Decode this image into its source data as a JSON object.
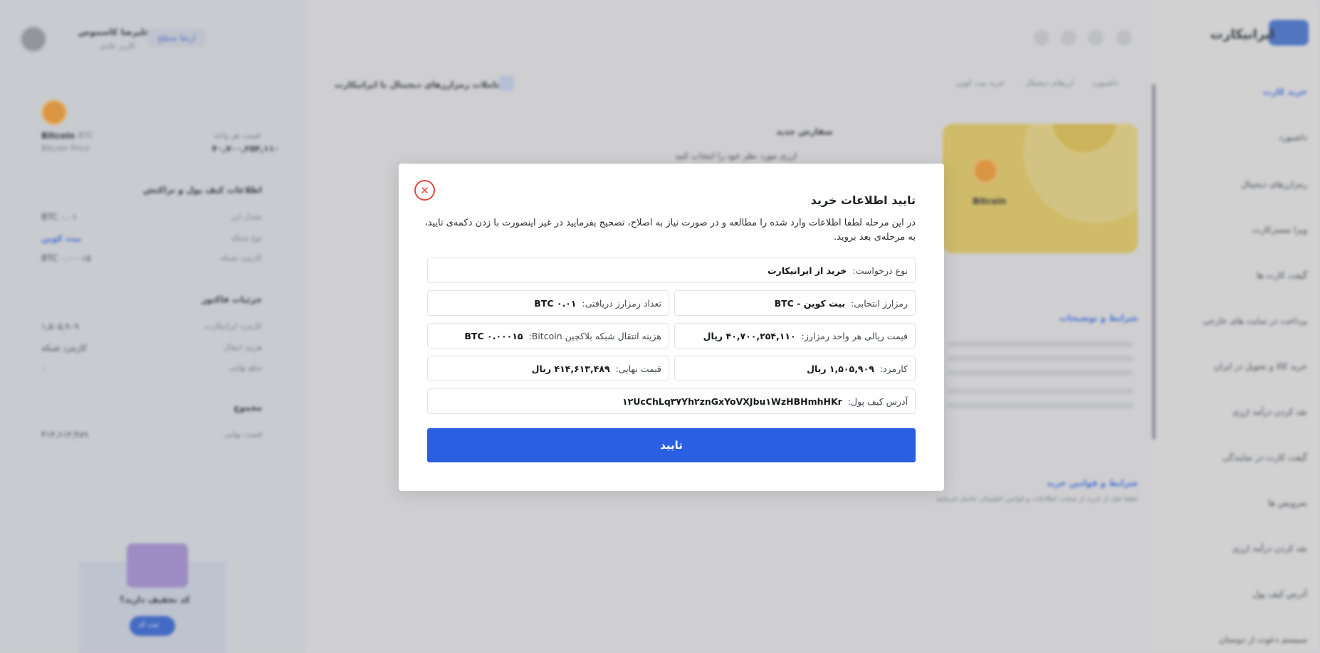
{
  "background": {
    "brand": "ایرانیکارت",
    "header": {
      "user_name": "علیرضا کاسموس",
      "user_role": "کاربر عادی",
      "profile_button": "ارتقا سطح",
      "breadcrumb": [
        "داشبورد",
        "ارزهای دیجیتال",
        "خرید بیت کوین"
      ],
      "page_title": "معاملات رمزارزهای دیجیتال با ایرانیکارت"
    },
    "sidebar": {
      "items": [
        "خرید کارت",
        "داشبورد",
        "رمزارزهای دیجیتال",
        "ویزا مسترکارت",
        "گیفت کارت ها",
        "پرداخت در سایت های خارجی",
        "خرید کالا و تحویل در ایران",
        "نقد کردن درآمد ارزی",
        "گیفت کارت در نمایندگی",
        "سرویس ها",
        "نقد کردن درآمد ارزی",
        "آدرس کیف پول",
        "سیستم دعوت از دوستان"
      ]
    },
    "main": {
      "section_title": "سفارش جدید",
      "section_subtitle": "ارزی مورد نظر خود را انتخاب کنید",
      "card_label": "Bitcoin",
      "link_1": "شرایط و توضیحات",
      "link_2": "شرایط و قوانین خرید",
      "rules_text": "لطفا قبل از خرید از صحت اطلاعات و قوانین اطمینان حاصل فرمایید"
    },
    "summary": {
      "coin_name": "Bitcoin",
      "coin_symbol": "BTC",
      "coin_sub": "Bitcoin Price",
      "price_label": "قیمت هر واحد",
      "price_value": "۴۰,۷۰۰,۲۵۴,۱۱۰",
      "info_title": "اطلاعات کیف پول و تراکنش",
      "info_rows": [
        [
          "مقدار ارز",
          "۰.۰۱ BTC"
        ],
        [
          "نوع شبکه",
          "بیت کوین"
        ],
        [
          "کارمزد شبکه",
          "۰.۰۰۰۱۵ BTC"
        ]
      ],
      "invoice_title": "جزئیات فاکتور",
      "invoice_rows": [
        [
          "کارمزد ایرانیکارت",
          "۱,۵۰۵,۹۰۹"
        ],
        [
          "هزینه انتقال",
          "کارمزد شبکه"
        ],
        [
          "مبلغ نهایی",
          "۰"
        ]
      ],
      "final_title": "مجموع",
      "final_row": [
        "قیمت نهایی",
        "۴۱۴,۶۱۳,۴۸۹"
      ],
      "promo_title": "کد تخفیف دارید؟",
      "promo_button": "ثبت کد"
    }
  },
  "modal": {
    "title": "تایید اطلاعات خرید",
    "description": "در این مرحله لطفا اطلاعات وارد شده را مطالعه و در صورت نیاز به اصلاح، تصحیح بفرمایید در غیر اینصورت با زدن دکمه‌ی تایید، به مرحله‌ی بعد بروید.",
    "fields": {
      "request_type": {
        "label": "نوع درخواست:",
        "value": "خرید از ایرانیکارت"
      },
      "selected_coin": {
        "label": "رمزارز انتخابی:",
        "value": "بیت کوین - BTC"
      },
      "received_amount": {
        "label": "تعداد رمزارز دریافتی:",
        "value": "۰.۰۱ BTC"
      },
      "unit_price": {
        "label": "قیمت ریالی هر واحد رمزارز:",
        "value": "۴۰,۷۰۰,۲۵۴,۱۱۰ ریال"
      },
      "network_fee": {
        "label": "هزینه انتقال شبکه بلاکچین Bitcoin:",
        "value": "۰.۰۰۰۱۵ BTC"
      },
      "commission": {
        "label": "کارمزد:",
        "value": "۱,۵۰۵,۹۰۹ ریال"
      },
      "final_price": {
        "label": "قیمت نهایی:",
        "value": "۴۱۴,۶۱۳,۴۸۹ ریال"
      },
      "wallet_address": {
        "label": "آدرس کیف پول:",
        "value": "۱۲UcChLq۳۷Yh۲znGxYoVXJbu۱WzHBHmhHKr"
      }
    },
    "confirm_label": "تایید",
    "close_icon": "close-icon",
    "colors": {
      "accent": "#2a5fe3",
      "close": "#e04a40"
    }
  }
}
